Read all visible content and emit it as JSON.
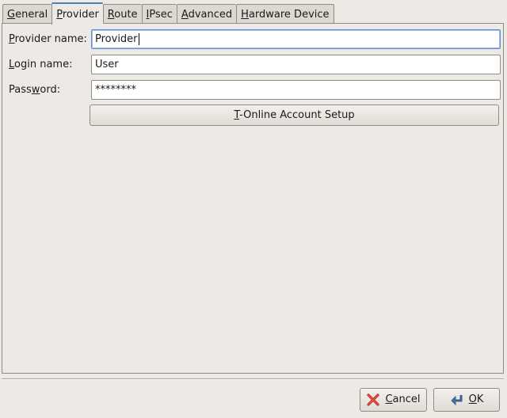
{
  "tabs": [
    {
      "pre": "",
      "key": "G",
      "post": "eneral",
      "active": false
    },
    {
      "pre": "",
      "key": "P",
      "post": "rovider",
      "active": true
    },
    {
      "pre": "",
      "key": "R",
      "post": "oute",
      "active": false
    },
    {
      "pre": "",
      "key": "I",
      "post": "Psec",
      "active": false
    },
    {
      "pre": "",
      "key": "A",
      "post": "dvanced",
      "active": false
    },
    {
      "pre": "",
      "key": "H",
      "post": "ardware Device",
      "active": false
    }
  ],
  "form": {
    "provider_label": {
      "pre": "",
      "key": "P",
      "post": "rovider name:"
    },
    "provider_value": "Provider",
    "login_label": {
      "pre": "",
      "key": "L",
      "post": "ogin name:"
    },
    "login_value": "User",
    "password_label": {
      "pre": "Pass",
      "key": "w",
      "post": "ord:"
    },
    "password_value": "********",
    "setup_button": {
      "pre": "",
      "key": "T",
      "post": "-Online Account Setup"
    }
  },
  "dialog": {
    "cancel": {
      "pre": "",
      "key": "C",
      "post": "ancel"
    },
    "ok": {
      "pre": "",
      "key": "O",
      "post": "K"
    }
  },
  "colors": {
    "accent": "#4b7dc0",
    "cancel_icon": "#cc2a1f",
    "ok_icon": "#4a6fa5"
  },
  "icons": {
    "cancel": "cancel-x-icon",
    "ok": "ok-return-icon"
  }
}
